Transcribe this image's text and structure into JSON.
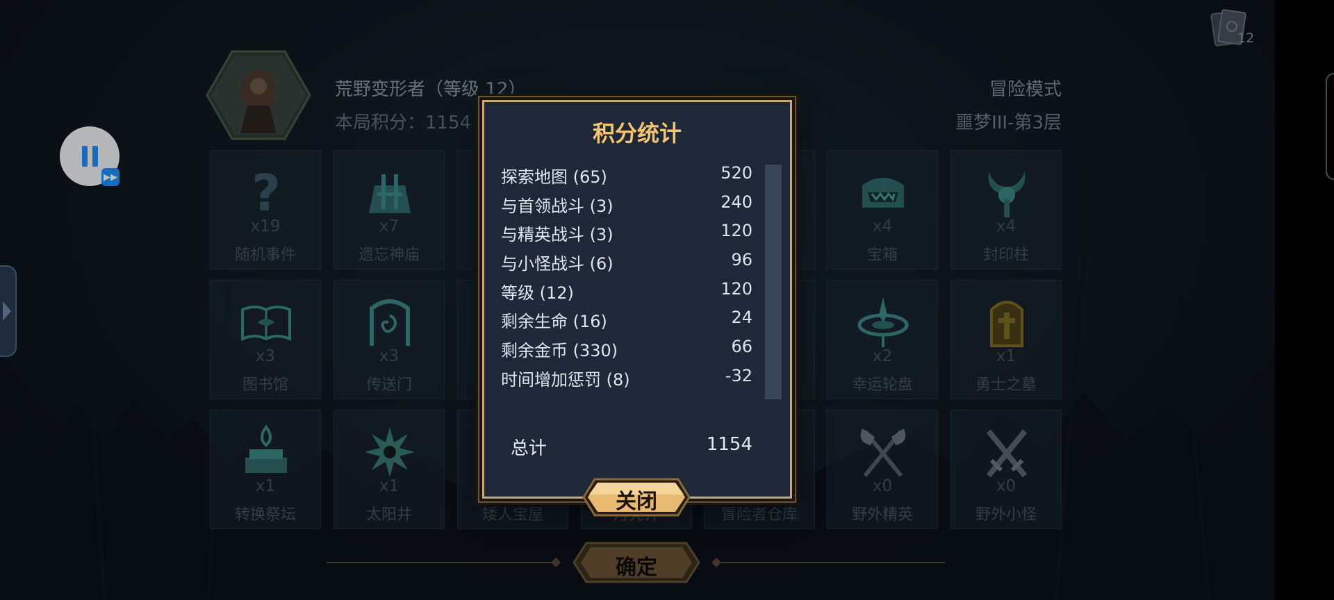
{
  "header": {
    "hero_name": "荒野变形者（等级 12）",
    "score_text": "本局积分：1154",
    "mode": "冒险模式",
    "difficulty": "噩梦III-第3层",
    "deck_count": "12"
  },
  "grid": [
    {
      "name": "随机事件",
      "count": "x19",
      "icon": "question-icon"
    },
    {
      "name": "遗忘神庙",
      "count": "x7",
      "icon": "temple-icon"
    },
    {
      "name": "",
      "count": "",
      "icon": "hidden-icon"
    },
    {
      "name": "",
      "count": "",
      "icon": "hidden-icon"
    },
    {
      "name": "",
      "count": "",
      "icon": "hidden-icon"
    },
    {
      "name": "宝箱",
      "count": "x4",
      "icon": "chest-icon"
    },
    {
      "name": "封印柱",
      "count": "x4",
      "icon": "seal-pillar-icon"
    },
    {
      "name": "图书馆",
      "count": "x3",
      "icon": "book-icon"
    },
    {
      "name": "传送门",
      "count": "x3",
      "icon": "portal-icon"
    },
    {
      "name": "",
      "count": "",
      "icon": "hidden-icon"
    },
    {
      "name": "",
      "count": "",
      "icon": "hidden-icon"
    },
    {
      "name": "",
      "count": "",
      "icon": "hidden-icon"
    },
    {
      "name": "幸运轮盘",
      "count": "x2",
      "icon": "wheel-icon"
    },
    {
      "name": "勇士之墓",
      "count": "x1",
      "icon": "tomb-icon"
    },
    {
      "name": "转换祭坛",
      "count": "x1",
      "icon": "altar-icon"
    },
    {
      "name": "太阳井",
      "count": "x1",
      "icon": "sun-well-icon"
    },
    {
      "name": "矮人宝屋",
      "count": "",
      "icon": "hidden-icon"
    },
    {
      "name": "月亮井",
      "count": "",
      "icon": "hidden-icon"
    },
    {
      "name": "冒险者仓库",
      "count": "",
      "icon": "hidden-icon"
    },
    {
      "name": "野外精英",
      "count": "x0",
      "icon": "elite-axe-icon"
    },
    {
      "name": "野外小怪",
      "count": "x0",
      "icon": "crossed-swords-icon"
    }
  ],
  "confirm_label": "确定",
  "modal": {
    "title": "积分统计",
    "rows": [
      {
        "label": "探索地图 (65)",
        "value": "520"
      },
      {
        "label": "与首领战斗 (3)",
        "value": "240"
      },
      {
        "label": "与精英战斗 (3)",
        "value": "120"
      },
      {
        "label": "与小怪战斗 (6)",
        "value": "96"
      },
      {
        "label": "等级 (12)",
        "value": "120"
      },
      {
        "label": "剩余生命 (16)",
        "value": "24"
      },
      {
        "label": "剩余金币 (330)",
        "value": "66"
      },
      {
        "label": "时间增加惩罚 (8)",
        "value": "-32"
      }
    ],
    "total_label": "总计",
    "total_value": "1154",
    "close_label": "关闭"
  },
  "colors": {
    "accent_gold": "#f4c66e",
    "button_gold": "#e8b970",
    "pause_blue": "#1e90ff"
  }
}
